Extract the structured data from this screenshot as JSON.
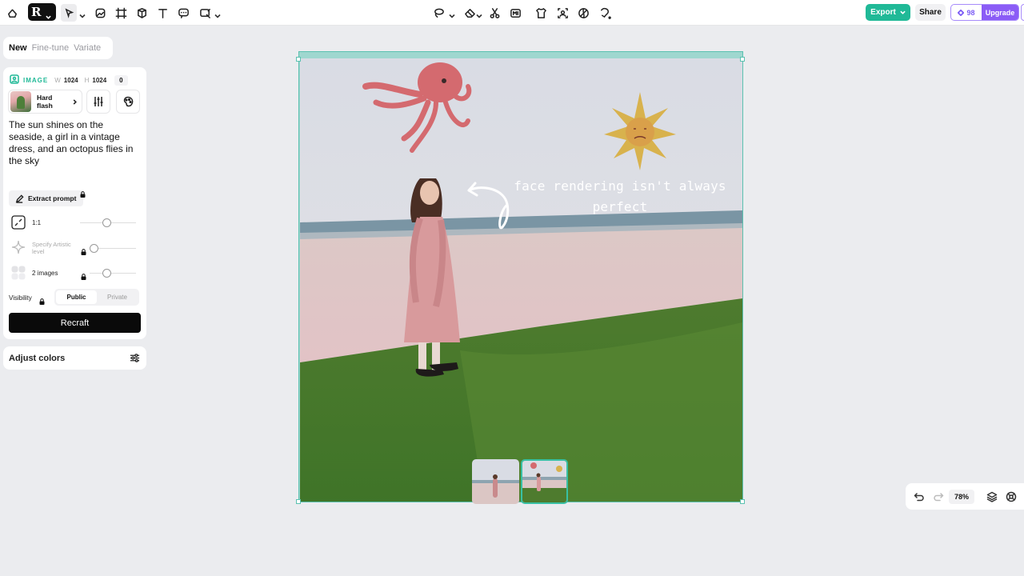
{
  "toolbar": {
    "export_label": "Export",
    "share_label": "Share",
    "credits": "98",
    "upgrade_label": "Upgrade"
  },
  "panel": {
    "tabs": [
      {
        "label": "New",
        "active": true
      },
      {
        "label": "Fine-tune",
        "active": false
      },
      {
        "label": "Variate",
        "active": false
      }
    ],
    "image_label": "IMAGE",
    "width_label": "W",
    "width_value": "1024",
    "height_label": "H",
    "height_value": "1024",
    "seed_value": "0",
    "style_name": "Hard flash",
    "prompt": "The sun shines on the seaside, a girl in a vintage dress, and an octopus flies in the sky",
    "extract_label": "Extract prompt",
    "aspect_label": "1:1",
    "artistic_label": "Specify Artistic level",
    "images_label": "2 images",
    "visibility_label": "Visibility",
    "visibility_public": "Public",
    "visibility_private": "Private",
    "visibility_selected": "Public",
    "recraft_label": "Recraft",
    "adjust_label": "Adjust colors"
  },
  "canvas": {
    "annotation": "face rendering isn't always perfect",
    "thumbnails": 2,
    "active_thumbnail": 2
  },
  "zoom": {
    "value": "78%"
  },
  "colors": {
    "accent": "#20b997",
    "upgrade": "#8b5cf6",
    "primary_button": "#0a0a0a"
  }
}
